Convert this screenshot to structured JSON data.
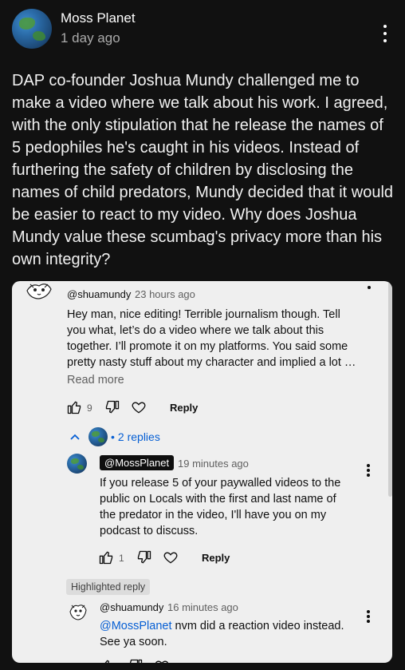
{
  "post": {
    "author": "Moss Planet",
    "time": "1 day ago",
    "text": "DAP co-founder Joshua Mundy challenged me to make a video where we talk about his work. I agreed, with the only stipulation that he release the names of 5 pedophiles he's caught in his videos. Instead of furthering the safety of children by disclosing the names of child predators, Mundy decided that it would be easier to react to my video. Why does Joshua Mundy value these scumbag's privacy more than his own integrity?"
  },
  "screenshot": {
    "comment": {
      "author": "@shuamundy",
      "time": "23 hours ago",
      "text": "Hey man, nice editing! Terrible journalism though. Tell you what, let’s do a video where we talk about this together. I’ll promote it on my platforms. You said some pretty nasty stuff about my character and implied a lot …",
      "read_more": "Read more",
      "like_count": "9",
      "reply_label": "Reply"
    },
    "replies_toggle": "2 replies",
    "reply1": {
      "author": "@MossPlanet",
      "time": "19 minutes ago",
      "text": "If you release 5 of your paywalled videos to the public on Locals with the first and last name of the predator in the video, I'll have you on my podcast to discuss.",
      "like_count": "1",
      "reply_label": "Reply"
    },
    "highlighted_label": "Highlighted reply",
    "reply2": {
      "author": "@shuamundy",
      "time": "16 minutes ago",
      "mention": "@MossPlanet",
      "text": " nvm did a reaction video instead. See ya soon."
    }
  },
  "icons": {
    "like": "thumbs-up-icon",
    "dislike": "thumbs-down-icon",
    "heart": "heart-icon",
    "more": "more-vert-icon",
    "chevron": "chevron-up-icon"
  },
  "colors": {
    "background": "#111111",
    "card": "#efefef",
    "link": "#065fd4",
    "secondary_text": "#aaaaaa"
  }
}
